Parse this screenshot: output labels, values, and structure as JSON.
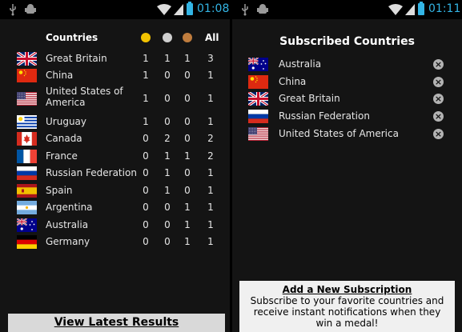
{
  "left": {
    "status": {
      "time": "01:08"
    },
    "table": {
      "header": {
        "countries": "Countries",
        "all": "All"
      },
      "medal_colors": {
        "gold": "#f2c200",
        "silver": "#cfcfcf",
        "bronze": "#c07d3e"
      },
      "rows": [
        {
          "country": "Great Britain",
          "flag": "flag-gb",
          "gold": "1",
          "silver": "1",
          "bronze": "1",
          "all": "3"
        },
        {
          "country": "China",
          "flag": "flag-cn",
          "gold": "1",
          "silver": "0",
          "bronze": "0",
          "all": "1"
        },
        {
          "country": "United States of America",
          "flag": "flag-us",
          "gold": "1",
          "silver": "0",
          "bronze": "0",
          "all": "1"
        },
        {
          "country": "Uruguay",
          "flag": "flag-uy",
          "gold": "1",
          "silver": "0",
          "bronze": "0",
          "all": "1"
        },
        {
          "country": "Canada",
          "flag": "flag-ca",
          "gold": "0",
          "silver": "2",
          "bronze": "0",
          "all": "2"
        },
        {
          "country": "France",
          "flag": "flag-fr",
          "gold": "0",
          "silver": "1",
          "bronze": "1",
          "all": "2"
        },
        {
          "country": "Russian Federation",
          "flag": "flag-ru",
          "gold": "0",
          "silver": "1",
          "bronze": "0",
          "all": "1"
        },
        {
          "country": "Spain",
          "flag": "flag-es",
          "gold": "0",
          "silver": "1",
          "bronze": "0",
          "all": "1"
        },
        {
          "country": "Argentina",
          "flag": "flag-ar",
          "gold": "0",
          "silver": "0",
          "bronze": "1",
          "all": "1"
        },
        {
          "country": "Australia",
          "flag": "flag-au",
          "gold": "0",
          "silver": "0",
          "bronze": "1",
          "all": "1"
        },
        {
          "country": "Germany",
          "flag": "flag-de",
          "gold": "0",
          "silver": "0",
          "bronze": "1",
          "all": "1"
        }
      ]
    },
    "button": {
      "label": "View Latest Results"
    }
  },
  "right": {
    "status": {
      "time": "01:11"
    },
    "title": "Subscribed Countries",
    "subscriptions": [
      {
        "country": "Australia",
        "flag": "flag-au"
      },
      {
        "country": "China",
        "flag": "flag-cn"
      },
      {
        "country": "Great Britain",
        "flag": "flag-gb"
      },
      {
        "country": "Russian Federation",
        "flag": "flag-ru"
      },
      {
        "country": "United States of America",
        "flag": "flag-us"
      }
    ],
    "add_box": {
      "title": "Add a New Subscription",
      "text": "Subscribe to your favorite countries and receive instant notifications when they win a medal!"
    }
  }
}
